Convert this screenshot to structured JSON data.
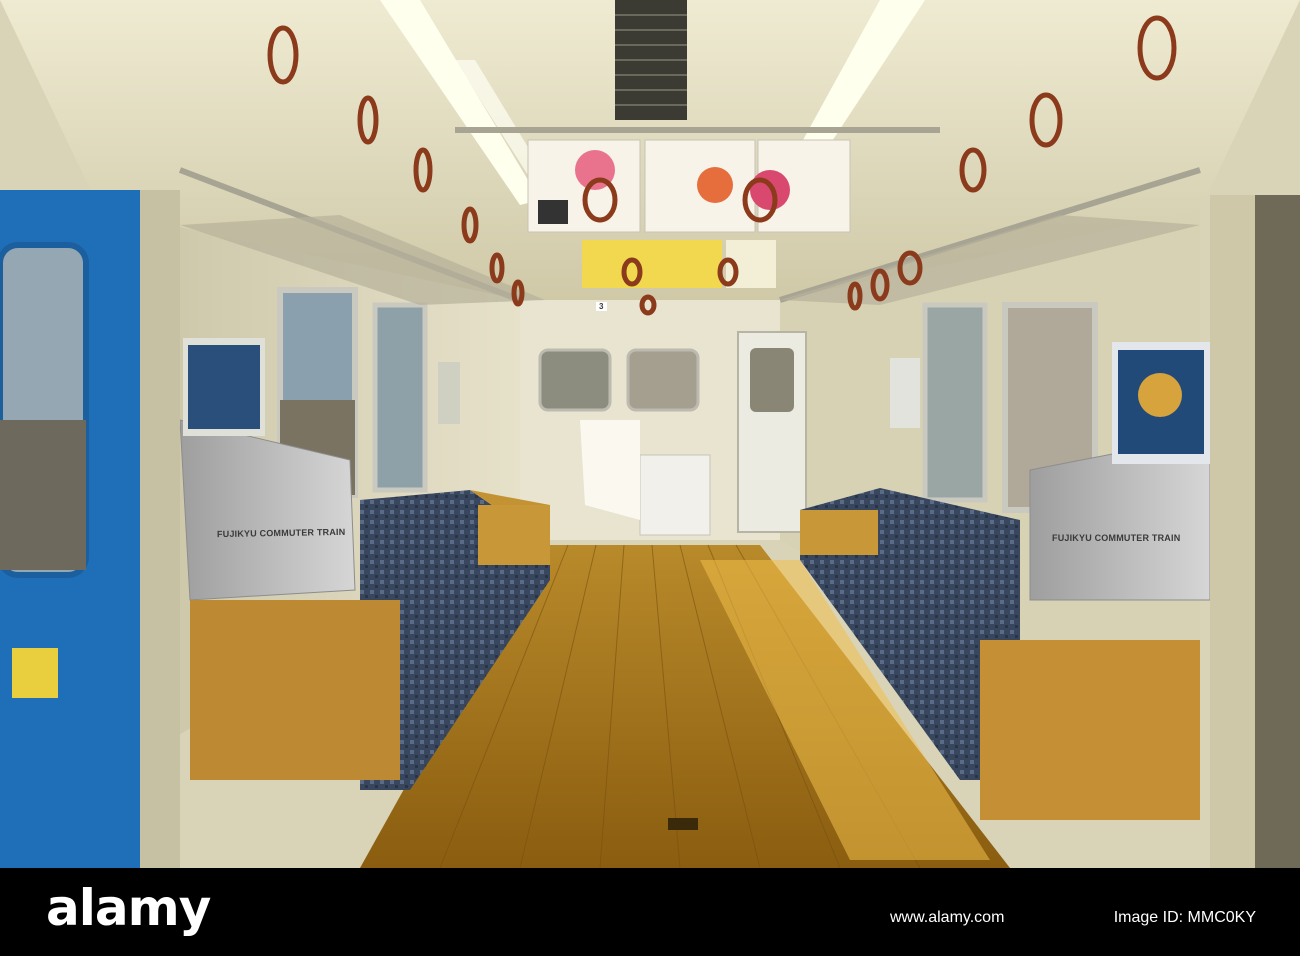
{
  "photo": {
    "sign_left": "FUJIKYU COMMUTER TRAIN",
    "sign_right": "FUJIKYU COMMUTER TRAIN",
    "door_number": "3"
  },
  "watermark": {
    "logo": "alamy",
    "image_id": "Image ID: MMC0KY",
    "url": "www.alamy.com"
  },
  "colors": {
    "floor": "#c8961e",
    "seat": "#3c4a63",
    "door_blue": "#1f6fb8",
    "ceiling": "#e4e0c6"
  }
}
